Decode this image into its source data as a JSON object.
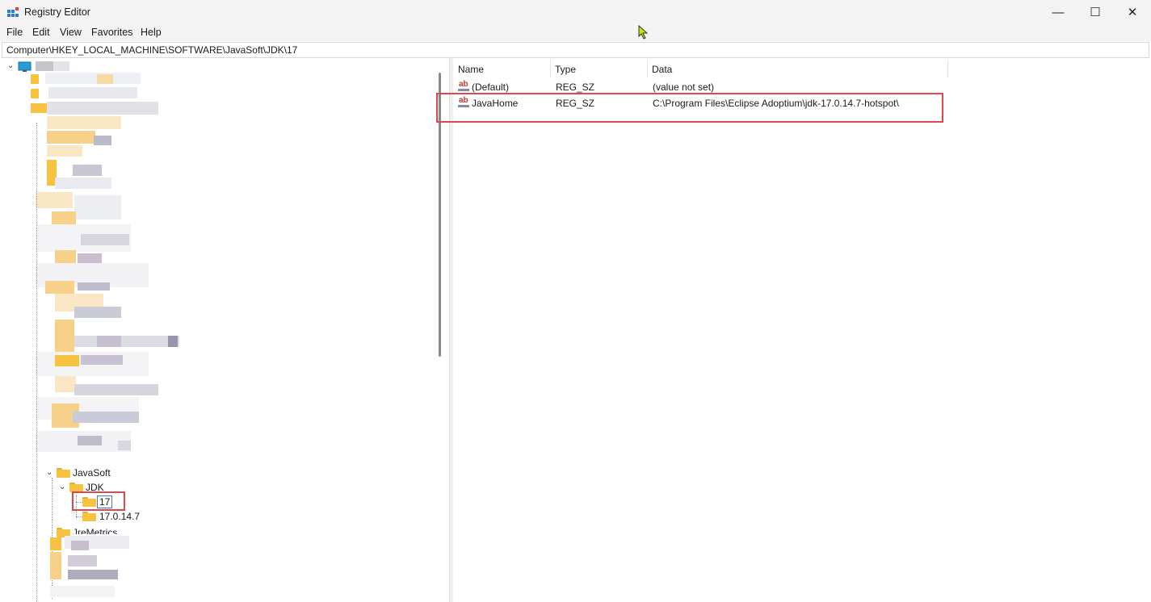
{
  "window": {
    "title": "Registry Editor",
    "controls": {
      "minimize": "—",
      "maximize": "☐",
      "close": "✕"
    }
  },
  "menu": [
    "File",
    "Edit",
    "View",
    "Favorites",
    "Help"
  ],
  "address": "Computer\\HKEY_LOCAL_MACHINE\\SOFTWARE\\JavaSoft\\JDK\\17",
  "tree": {
    "javasoft": "JavaSoft",
    "jdk": "JDK",
    "selected": "17",
    "sibling": "17.0.14.7",
    "partial": "JreMetrics"
  },
  "list": {
    "columns": [
      "Name",
      "Type",
      "Data"
    ],
    "rows": [
      {
        "name": "(Default)",
        "type": "REG_SZ",
        "data": "(value not set)"
      },
      {
        "name": "JavaHome",
        "type": "REG_SZ",
        "data": "C:\\Program Files\\Eclipse Adoptium\\jdk-17.0.14.7-hotspot\\"
      }
    ]
  },
  "colors": {
    "highlight": "#e0474c",
    "folder": "#f5c242",
    "selection": "#3b78d8"
  }
}
